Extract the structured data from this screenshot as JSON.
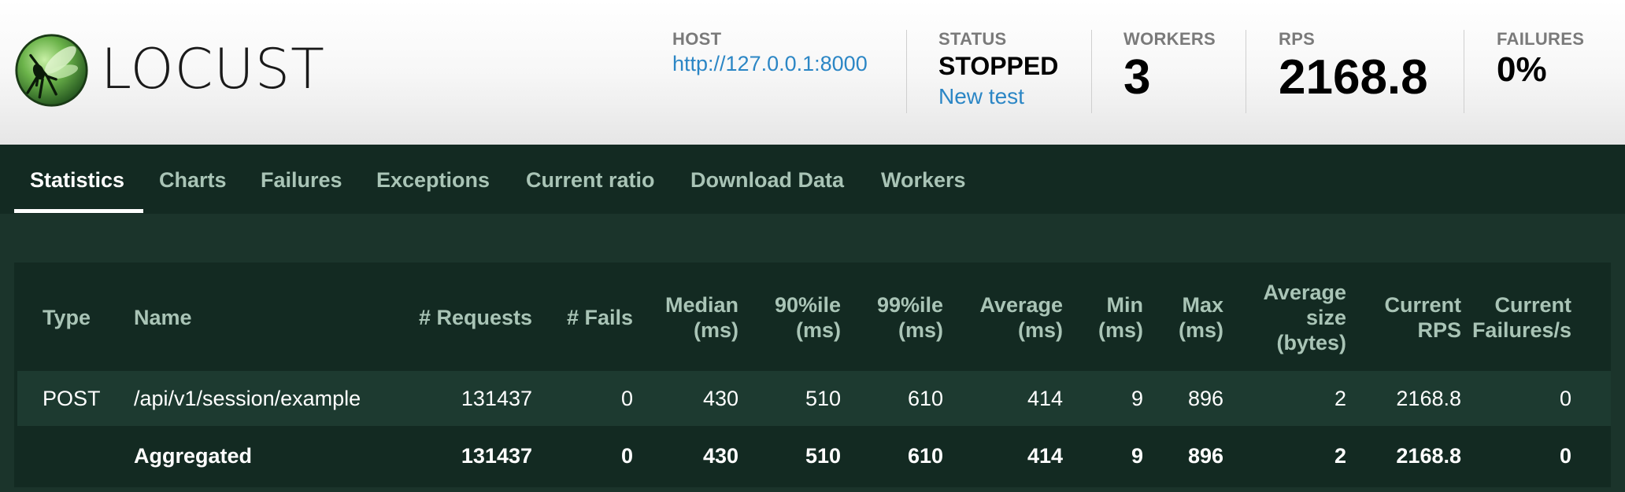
{
  "header": {
    "logo_text": "LOCUST",
    "host": {
      "label": "HOST",
      "value": "http://127.0.0.1:8000"
    },
    "status": {
      "label": "STATUS",
      "value": "STOPPED",
      "action": "New test"
    },
    "workers": {
      "label": "WORKERS",
      "value": "3"
    },
    "rps": {
      "label": "RPS",
      "value": "2168.8"
    },
    "failures": {
      "label": "FAILURES",
      "value": "0%"
    }
  },
  "tabs": [
    {
      "label": "Statistics",
      "active": true
    },
    {
      "label": "Charts"
    },
    {
      "label": "Failures"
    },
    {
      "label": "Exceptions"
    },
    {
      "label": "Current ratio"
    },
    {
      "label": "Download Data"
    },
    {
      "label": "Workers"
    }
  ],
  "table": {
    "headers": {
      "type": "Type",
      "name": "Name",
      "requests": "# Requests",
      "fails": "# Fails",
      "median_1": "Median",
      "median_2": "(ms)",
      "p90_1": "90%ile",
      "p90_2": "(ms)",
      "p99_1": "99%ile",
      "p99_2": "(ms)",
      "avg_1": "Average",
      "avg_2": "(ms)",
      "min_1": "Min",
      "min_2": "(ms)",
      "max_1": "Max",
      "max_2": "(ms)",
      "size_1": "Average",
      "size_2": "size",
      "size_3": "(bytes)",
      "rps_1": "Current",
      "rps_2": "RPS",
      "fps_1": "Current",
      "fps_2": "Failures/s"
    },
    "rows": [
      {
        "type": "POST",
        "name": "/api/v1/session/example",
        "requests": "131437",
        "fails": "0",
        "median": "430",
        "p90": "510",
        "p99": "610",
        "average": "414",
        "min": "9",
        "max": "896",
        "avg_size": "2",
        "current_rps": "2168.8",
        "current_failures": "0"
      }
    ],
    "aggregated": {
      "type": "",
      "name": "Aggregated",
      "requests": "131437",
      "fails": "0",
      "median": "430",
      "p90": "510",
      "p99": "610",
      "average": "414",
      "min": "9",
      "max": "896",
      "avg_size": "2",
      "current_rps": "2168.8",
      "current_failures": "0"
    }
  },
  "colors": {
    "header_bg": "#f4f4f4",
    "nav_bg": "#132a22",
    "page_bg": "#1b342b",
    "row_alt_bg": "#1d3a30",
    "link": "#2b86c5",
    "header_text": "#a9c4b6"
  }
}
